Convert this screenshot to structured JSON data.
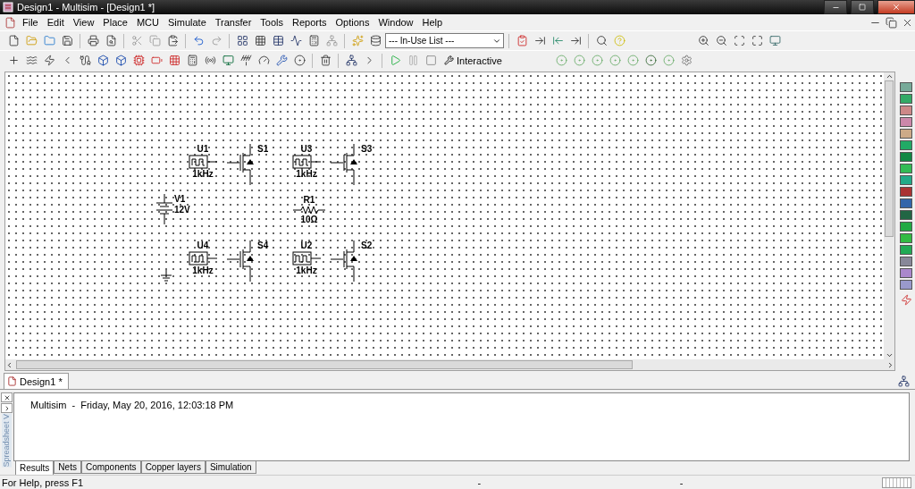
{
  "window": {
    "title": "Design1 - Multisim - [Design1 *]"
  },
  "menu": [
    "File",
    "Edit",
    "View",
    "Place",
    "MCU",
    "Simulate",
    "Transfer",
    "Tools",
    "Reports",
    "Options",
    "Window",
    "Help"
  ],
  "toolbar": {
    "component_list": "--- In-Use List ---",
    "interactive": "Interactive"
  },
  "schematic": {
    "parts": [
      {
        "kind": "pulse_source",
        "ref": "U1",
        "value": "1kHz"
      },
      {
        "kind": "mosfet",
        "ref": "S1"
      },
      {
        "kind": "pulse_source",
        "ref": "U3",
        "value": "1kHz"
      },
      {
        "kind": "mosfet",
        "ref": "S3"
      },
      {
        "kind": "dc_source",
        "ref": "V1",
        "value": "12V"
      },
      {
        "kind": "resistor",
        "ref": "R1",
        "value": "10Ω"
      },
      {
        "kind": "pulse_source",
        "ref": "U4",
        "value": "1kHz"
      },
      {
        "kind": "mosfet",
        "ref": "S4"
      },
      {
        "kind": "pulse_source",
        "ref": "U2",
        "value": "1kHz"
      },
      {
        "kind": "mosfet",
        "ref": "S2"
      },
      {
        "kind": "ground"
      }
    ]
  },
  "design_tabs": [
    {
      "label": "Design1 *",
      "selected": true
    }
  ],
  "spreadsheet": {
    "side_label": "Spreadsheet V",
    "output": "Multisim  -  Friday, May 20, 2016, 12:03:18 PM",
    "tabs": [
      {
        "label": "Results",
        "selected": true
      },
      {
        "label": "Nets",
        "selected": false
      },
      {
        "label": "Components",
        "selected": false
      },
      {
        "label": "Copper layers",
        "selected": false
      },
      {
        "label": "Simulation",
        "selected": false
      }
    ]
  },
  "status_bar": {
    "help": "For Help, press F1",
    "fields": [
      "-",
      "-"
    ]
  }
}
